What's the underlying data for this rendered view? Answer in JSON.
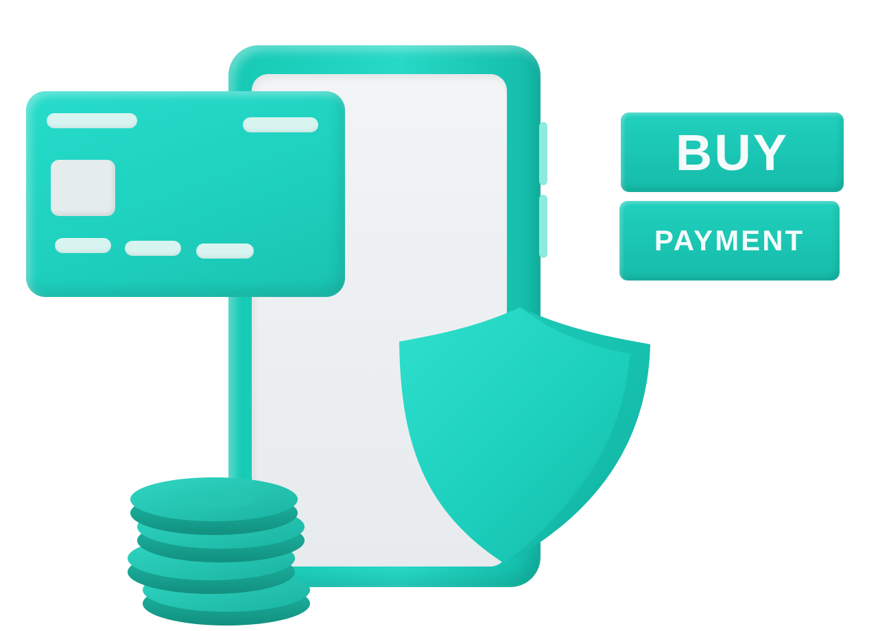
{
  "labels": {
    "buy": "BUY",
    "payment": "PAYMENT"
  },
  "colors": {
    "accent": "#1ecfbd",
    "accent_dark": "#139f90",
    "screen": "#eceff1",
    "label_text": "#f4fbfa",
    "background": "#ffffff"
  },
  "icons": {
    "card": "credit-card-icon",
    "phone": "smartphone-icon",
    "shield": "shield-icon",
    "coins": "coin-stack-icon"
  }
}
